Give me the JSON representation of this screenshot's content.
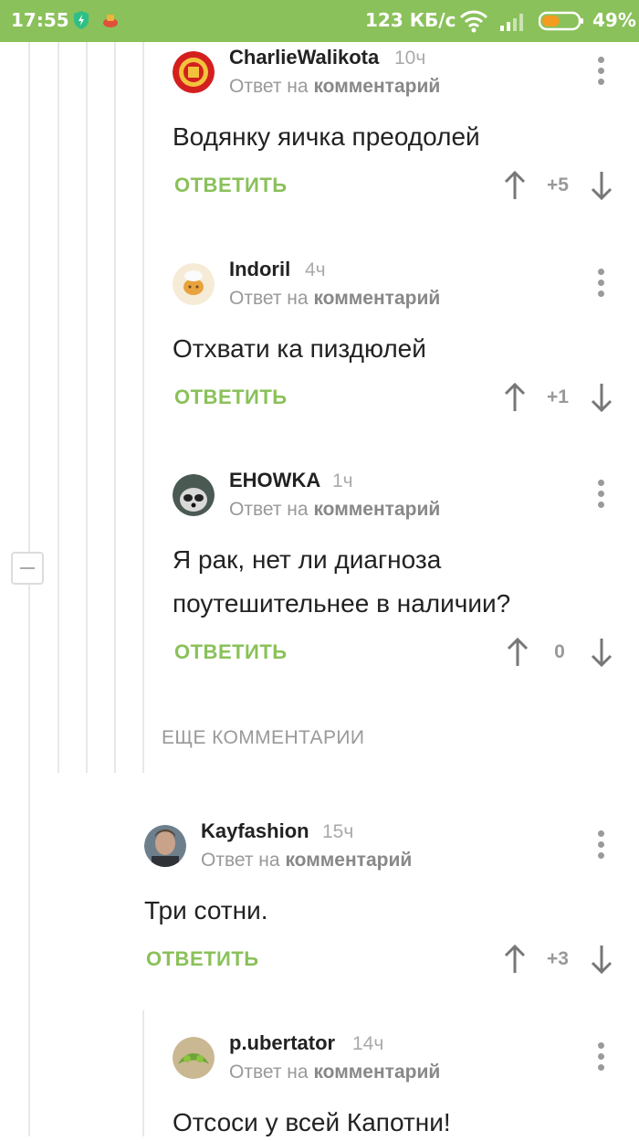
{
  "status_bar": {
    "time": "17:55",
    "network_speed": "123 КБ/с",
    "battery_percent": "49%",
    "battery_level": 0.49
  },
  "reply_prefix": "Ответ на",
  "reply_target": "комментарий",
  "reply_button_label": "ОТВЕТИТЬ",
  "more_comments_label": "ЕЩЕ КОММЕНТАРИИ",
  "comments": [
    {
      "author": "CharlieWalikota",
      "time": "10ч",
      "lines": [
        "Водянку яичка преодолей"
      ],
      "rating": "+5"
    },
    {
      "author": "Indoril",
      "time": "4ч",
      "lines": [
        "Отхвати ка пиздюлей"
      ],
      "rating": "+1"
    },
    {
      "author": "EHOWKA",
      "time": "1ч",
      "lines": [
        "Я рак, нет ли диагноза",
        "поутешительнее в наличии?"
      ],
      "rating": "0"
    },
    {
      "author": "Kayfashion",
      "time": "15ч",
      "lines": [
        "Три сотни."
      ],
      "rating": "+3"
    },
    {
      "author": "p.ubertator",
      "time": "14ч",
      "lines": [
        "Отсоси у всей Капотни!"
      ],
      "rating": ""
    }
  ],
  "colors": {
    "accent": "#8ac15a",
    "muted_text": "#999999",
    "body_text": "#222222"
  }
}
